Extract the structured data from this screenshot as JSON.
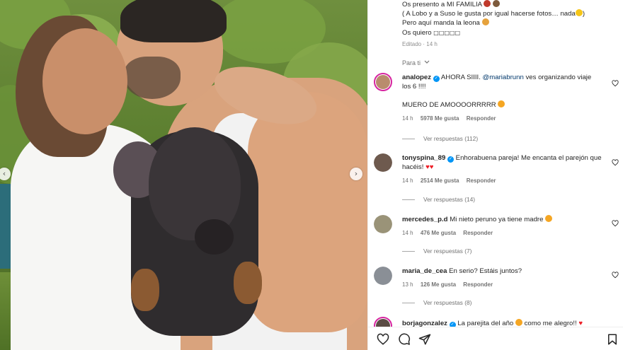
{
  "caption": {
    "lines": [
      "Os presento a MI FAMILIA",
      "( A Lobo y a Suso le gusta por igual hacerse fotos… nada",
      "Pero aquí manda la leona",
      "Os quiero"
    ],
    "line2_end": ")",
    "hearts": "□□□□□",
    "edited": "Editado",
    "time": "14 h"
  },
  "sort_label": "Para ti",
  "comments": [
    {
      "username": "analopez",
      "verified": true,
      "text_pre": "AHORA SIIII.",
      "mention": "@mariabrunn",
      "text_post": "ves organizando viaje los 6 !!!!",
      "text_second": "MUERO DE AMOOOORRRRR",
      "time": "14 h",
      "likes": "5978 Me gusta",
      "reply": "Responder",
      "view_replies": "Ver respuestas (112)",
      "avatar_color": "#b98c6d",
      "story_ring": true
    },
    {
      "username": "tonyspina_89",
      "verified": true,
      "text_pre": "Enhorabuena pareja! Me encanta el parejón que hacéis!",
      "time": "14 h",
      "likes": "2514 Me gusta",
      "reply": "Responder",
      "view_replies": "Ver respuestas (14)",
      "avatar_color": "#6e5a4e"
    },
    {
      "username": "mercedes_p.d",
      "verified": false,
      "text_pre": "Mi nieto peruno ya tiene madre",
      "time": "14 h",
      "likes": "476 Me gusta",
      "reply": "Responder",
      "view_replies": "Ver respuestas (7)",
      "avatar_color": "#9a9378"
    },
    {
      "username": "maria_de_cea",
      "verified": false,
      "text_pre": "En serio? Estáis juntos?",
      "time": "13 h",
      "likes": "126 Me gusta",
      "reply": "Responder",
      "view_replies": "Ver respuestas (8)",
      "avatar_color": "#8a8f96"
    },
    {
      "username": "borjagonzalez",
      "verified": true,
      "text_pre": "La parejita del año",
      "text_post": "como me alegro!!",
      "avatar_color": "#5b4c44",
      "story_ring": true
    }
  ],
  "colors": {
    "verified": "#0095f6",
    "mention": "#00376b",
    "heart_red": "#ed1c24",
    "story_ring": "#d6249f"
  },
  "icons": [
    "chevron-left-icon",
    "chevron-right-icon",
    "heart-icon",
    "comment-icon",
    "share-icon",
    "bookmark-icon",
    "chevron-down-icon",
    "verified-badge-icon"
  ]
}
